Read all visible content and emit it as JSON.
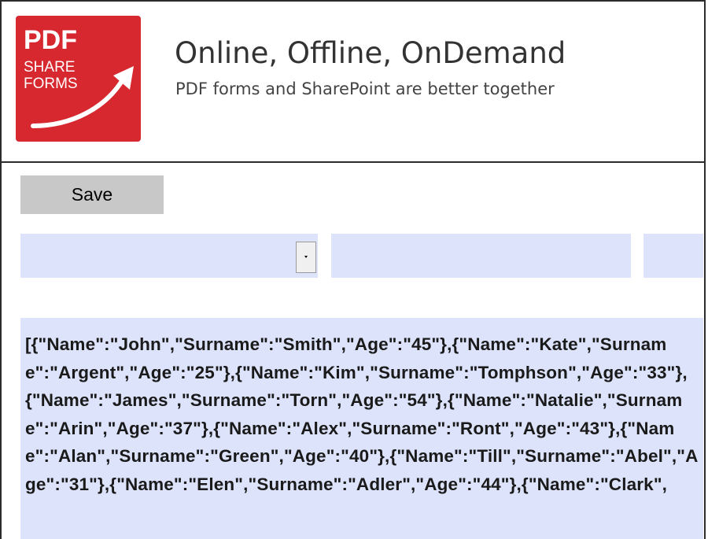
{
  "logo": {
    "line1": "PDF",
    "line2": "SHARE",
    "line3": "FORMS",
    "background": "#d7282f"
  },
  "header": {
    "title": "Online, Offline, OnDemand",
    "subtitle": "PDF forms and SharePoint are better together"
  },
  "toolbar": {
    "save_label": "Save"
  },
  "dropdown": {
    "selected": ""
  },
  "json_content": "[{\"Name\":\"John\",\"Surname\":\"Smith\",\"Age\":\"45\"},{\"Name\":\"Kate\",\"Surname\":\"Argent\",\"Age\":\"25\"},{\"Name\":\"Kim\",\"Surname\":\"Tomphson\",\"Age\":\"33\"},{\"Name\":\"James\",\"Surname\":\"Torn\",\"Age\":\"54\"},{\"Name\":\"Natalie\",\"Surname\":\"Arin\",\"Age\":\"37\"},{\"Name\":\"Alex\",\"Surname\":\"Ront\",\"Age\":\"43\"},{\"Name\":\"Alan\",\"Surname\":\"Green\",\"Age\":\"40\"},{\"Name\":\"Till\",\"Surname\":\"Abel\",\"Age\":\"31\"},{\"Name\":\"Elen\",\"Surname\":\"Adler\",\"Age\":\"44\"},{\"Name\":\"Clark\",",
  "colors": {
    "field_bg": "#dce3fb",
    "button_bg": "#c8c8c8",
    "brand_red": "#d7282f"
  },
  "icons": {
    "dropdown_arrow": "chevron-down-icon",
    "logo_arrow": "arrow-up-right-icon"
  }
}
